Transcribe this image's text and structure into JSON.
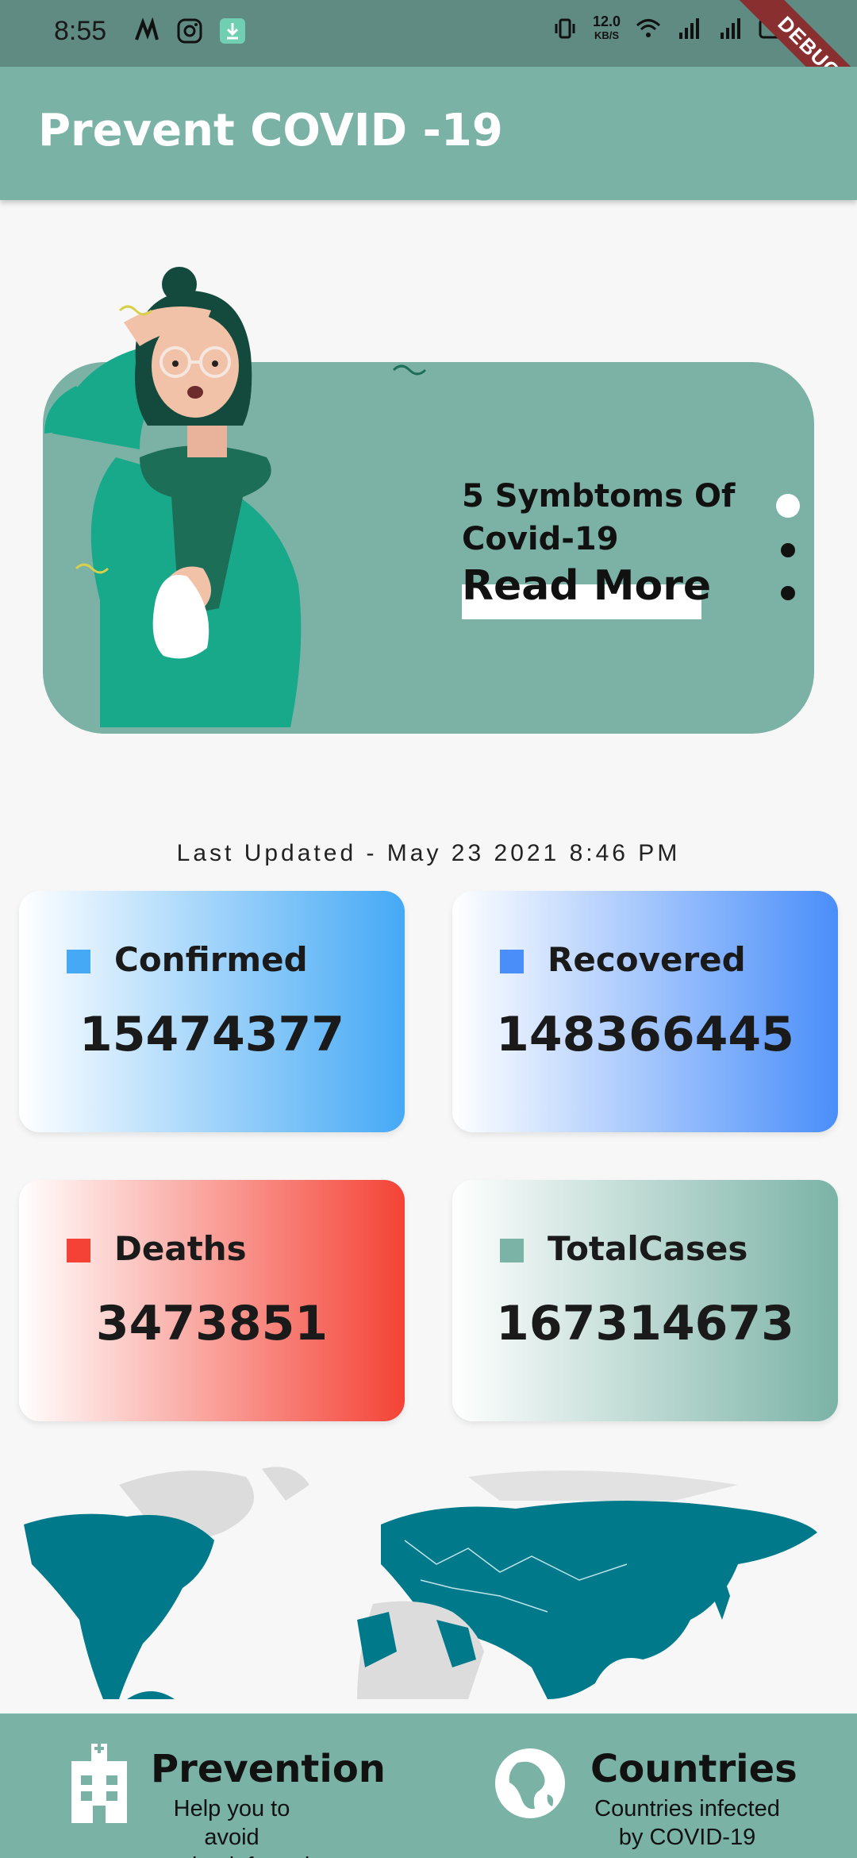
{
  "status_bar": {
    "time": "8:55",
    "speed_value": "12.0",
    "speed_unit": "KB/S",
    "debug_label": "DEBUG"
  },
  "app_bar": {
    "title": "Prevent COVID -19"
  },
  "banner": {
    "title": "5 Symbtoms Of Covid-19",
    "cta": "Read More",
    "page_count": 3,
    "active_page": 1
  },
  "updated": "Last Updated - May 23 2021 8:46 PM",
  "stats": {
    "confirmed": {
      "label": "Confirmed",
      "value": "15474377",
      "color": "#45a9f5"
    },
    "recovered": {
      "label": "Recovered",
      "value": "148366445",
      "color": "#4a8ef9"
    },
    "deaths": {
      "label": "Deaths",
      "value": "3473851",
      "color": "#f44336"
    },
    "total": {
      "label": "TotalCases",
      "value": "167314673",
      "color": "#7bb3a6"
    }
  },
  "bottom_nav": {
    "prevention": {
      "title": "Prevention",
      "subtitle_1": "Help you to avoid",
      "subtitle_2": "getting infected",
      "icon": "hospital-icon"
    },
    "countries": {
      "title": "Countries",
      "subtitle_1": "Countries infected",
      "subtitle_2": "by COVID-19",
      "icon": "globe-icon"
    }
  },
  "colors": {
    "accent": "#7ab2a6",
    "map_infected": "#007a8a",
    "map_other": "#dcdcdc"
  }
}
